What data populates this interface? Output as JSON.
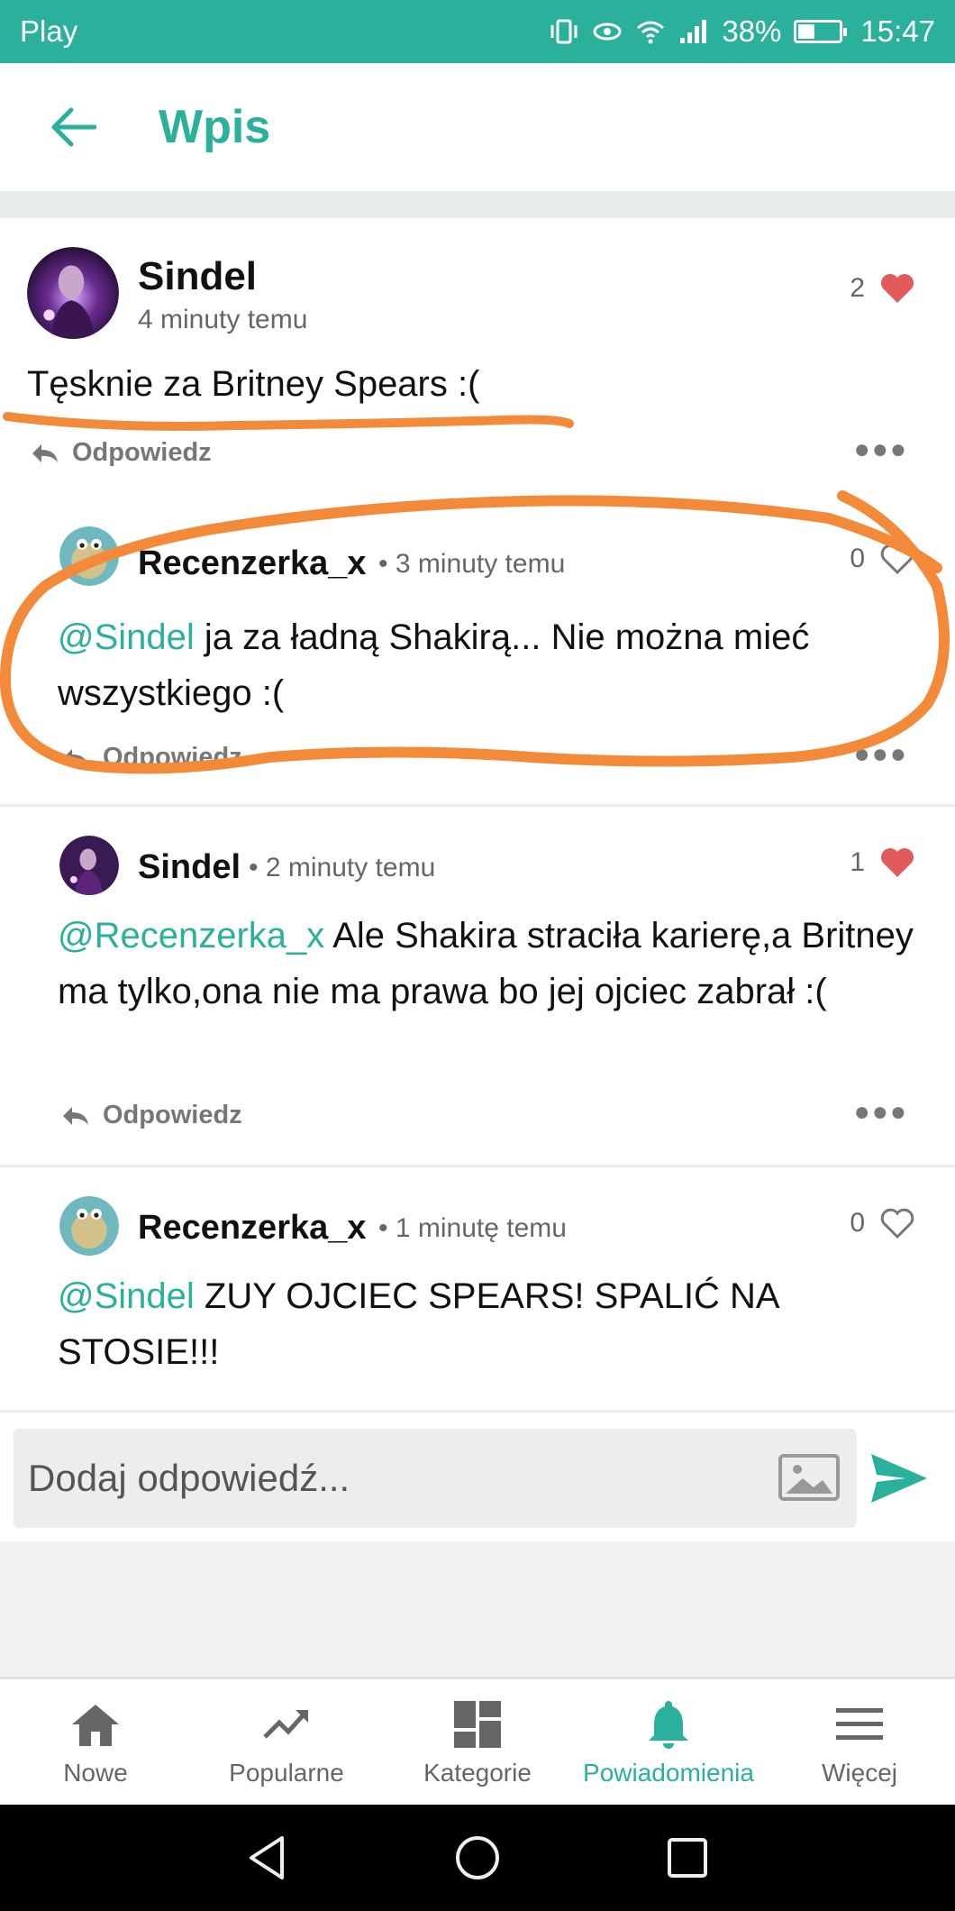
{
  "status_bar": {
    "carrier": "Play",
    "battery": "38%",
    "time": "15:47"
  },
  "header": {
    "title": "Wpis"
  },
  "post": {
    "author": "Sindel",
    "time": "4 minuty temu",
    "likes": "2",
    "text": "Tęsknie za Britney Spears :(",
    "reply_label": "Odpowiedz"
  },
  "comments": [
    {
      "author": "Recenzerka_x",
      "time": "3 minuty temu",
      "likes": "0",
      "mention": "@Sindel",
      "text": " ja za ładną Shakirą... Nie można mieć wszystkiego :(",
      "reply_label": "Odpowiedz"
    },
    {
      "author": "Sindel",
      "time": "2 minuty temu",
      "likes": "1",
      "mention": "@Recenzerka_x",
      "text": " Ale Shakira straciła karierę,a Britney ma tylko,ona nie ma prawa bo jej ojciec zabrał :(",
      "reply_label": "Odpowiedz"
    },
    {
      "author": "Recenzerka_x",
      "time": "1 minutę temu",
      "likes": "0",
      "mention": "@Sindel",
      "text": " ZUY OJCIEC SPEARS! SPALIĆ NA STOSIE!!!"
    }
  ],
  "reply_input": {
    "placeholder": "Dodaj odpowiedź..."
  },
  "bottom_nav": [
    {
      "label": "Nowe",
      "icon": "home-icon"
    },
    {
      "label": "Popularne",
      "icon": "trending-icon"
    },
    {
      "label": "Kategorie",
      "icon": "grid-icon"
    },
    {
      "label": "Powiadomienia",
      "icon": "bell-icon",
      "active": true
    },
    {
      "label": "Więcej",
      "icon": "menu-icon"
    }
  ],
  "colors": {
    "accent": "#2ab09b",
    "heart": "#e15b5b",
    "annotation": "#f28a3a"
  }
}
